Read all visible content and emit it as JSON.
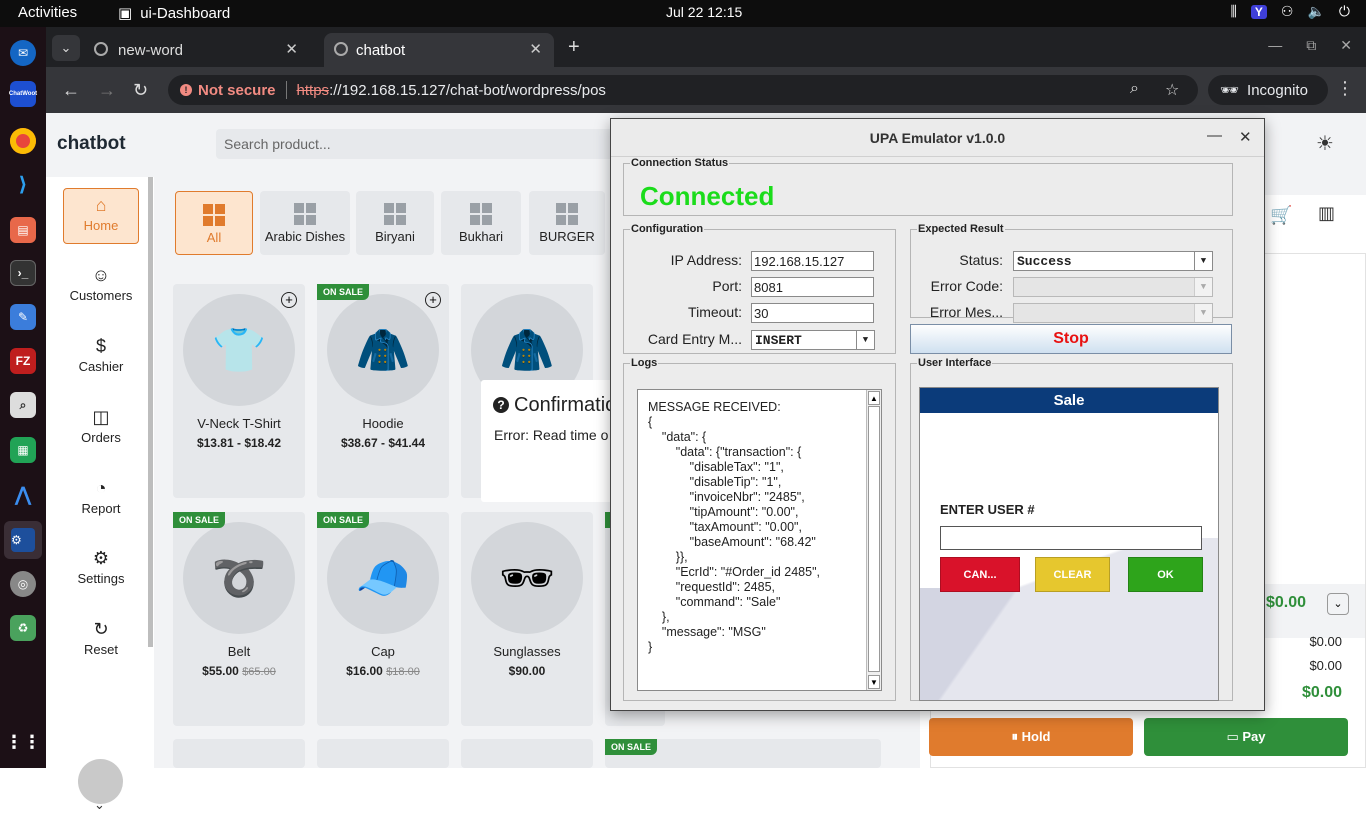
{
  "topbar": {
    "activities": "Activities",
    "app_name": "ui-Dashboard",
    "clock": "Jul 22  12:15",
    "tray_y": "Y"
  },
  "dock": {
    "items": [
      "thunderbird-icon",
      "chatwoot-icon",
      "chrome-icon",
      "vscode-icon",
      "files-icon",
      "terminal-icon",
      "text-editor-icon",
      "filezilla-icon",
      "search-icon",
      "spreadsheet-icon",
      "arch-icon",
      "upa-emulator-icon",
      "disk-icon",
      "trash-icon",
      "apps-grid-icon"
    ],
    "chatwoot_label": "ChatWoot",
    "filezilla_label": "FZ"
  },
  "browser": {
    "tabs": [
      {
        "title": "new-word"
      },
      {
        "title": "chatbot"
      }
    ],
    "not_secure": "Not secure",
    "url_scheme": "https",
    "url_rest": "://192.168.15.127/chat-bot/wordpress/pos",
    "incognito": "Incognito"
  },
  "pos": {
    "brand": "chatbot",
    "search_placeholder": "Search product...",
    "nav": [
      {
        "label": "Home",
        "icon": "home-icon"
      },
      {
        "label": "Customers",
        "icon": "user-icon"
      },
      {
        "label": "Cashier",
        "icon": "dollar-icon"
      },
      {
        "label": "Orders",
        "icon": "bag-icon"
      },
      {
        "label": "Report",
        "icon": "pie-chart-icon"
      },
      {
        "label": "Settings",
        "icon": "gear-icon"
      },
      {
        "label": "Reset",
        "icon": "refresh-icon"
      }
    ],
    "categories": [
      "All",
      "Arabic Dishes",
      "Biryani",
      "Bukhari",
      "BURGER"
    ],
    "sale_badge": "ON SALE",
    "products": [
      {
        "name": "V-Neck T-Shirt",
        "price": "$13.81 - $18.42",
        "old_price": "",
        "emoji": "👕"
      },
      {
        "name": "Hoodie",
        "price": "$38.67 - $41.44",
        "old_price": "",
        "emoji": "🧥"
      },
      {
        "name": "Belt",
        "price": "$55.00",
        "old_price": "$65.00",
        "emoji": "➰"
      },
      {
        "name": "Cap",
        "price": "$16.00",
        "old_price": "$18.00",
        "emoji": "🧢"
      },
      {
        "name": "Sunglasses",
        "price": "$90.00",
        "old_price": "",
        "emoji": "🕶"
      }
    ],
    "confirm": {
      "title": "Confirmatio",
      "message": "Error: Read time o"
    },
    "cart": {
      "total_top": "$0.00",
      "lines": [
        "$0.00",
        "$0.00"
      ],
      "grand_total": "$0.00",
      "hold": "Hold",
      "pay": "Pay"
    }
  },
  "upa": {
    "title": "UPA Emulator v1.0.0",
    "connection_status_legend": "Connection Status",
    "status_text": "Connected",
    "configuration_legend": "Configuration",
    "ip_label": "IP Address:",
    "ip_value": "192.168.15.127",
    "port_label": "Port:",
    "port_value": "8081",
    "timeout_label": "Timeout:",
    "timeout_value": "30",
    "card_entry_label": "Card Entry M...",
    "card_entry_value": "INSERT",
    "expected_result_legend": "Expected Result",
    "status_label": "Status:",
    "status_value": "Success",
    "error_code_label": "Error Code:",
    "error_message_label": "Error Mes...",
    "stop_button": "Stop",
    "logs_legend": "Logs",
    "log_text": "MESSAGE RECEIVED:\n{\n    \"data\": {\n        \"data\": {\"transaction\": {\n            \"disableTax\": \"1\",\n            \"disableTip\": \"1\",\n            \"invoiceNbr\": \"2485\",\n            \"tipAmount\": \"0.00\",\n            \"taxAmount\": \"0.00\",\n            \"baseAmount\": \"68.42\"\n        }},\n        \"EcrId\": \"#Order_id 2485\",\n        \"requestId\": 2485,\n        \"command\": \"Sale\"\n    },\n    \"message\": \"MSG\"\n}",
    "user_interface_legend": "User Interface",
    "ui_header": "Sale",
    "ui_prompt": "ENTER USER #",
    "ui_cancel": "CAN...",
    "ui_clear": "CLEAR",
    "ui_ok": "OK",
    "colors": {
      "connected": "#1bdc1b",
      "stop": "#e81111",
      "header": "#0b3b7a",
      "cancel": "#d9122a",
      "clear": "#e6c72e",
      "ok": "#2ea41b"
    }
  }
}
